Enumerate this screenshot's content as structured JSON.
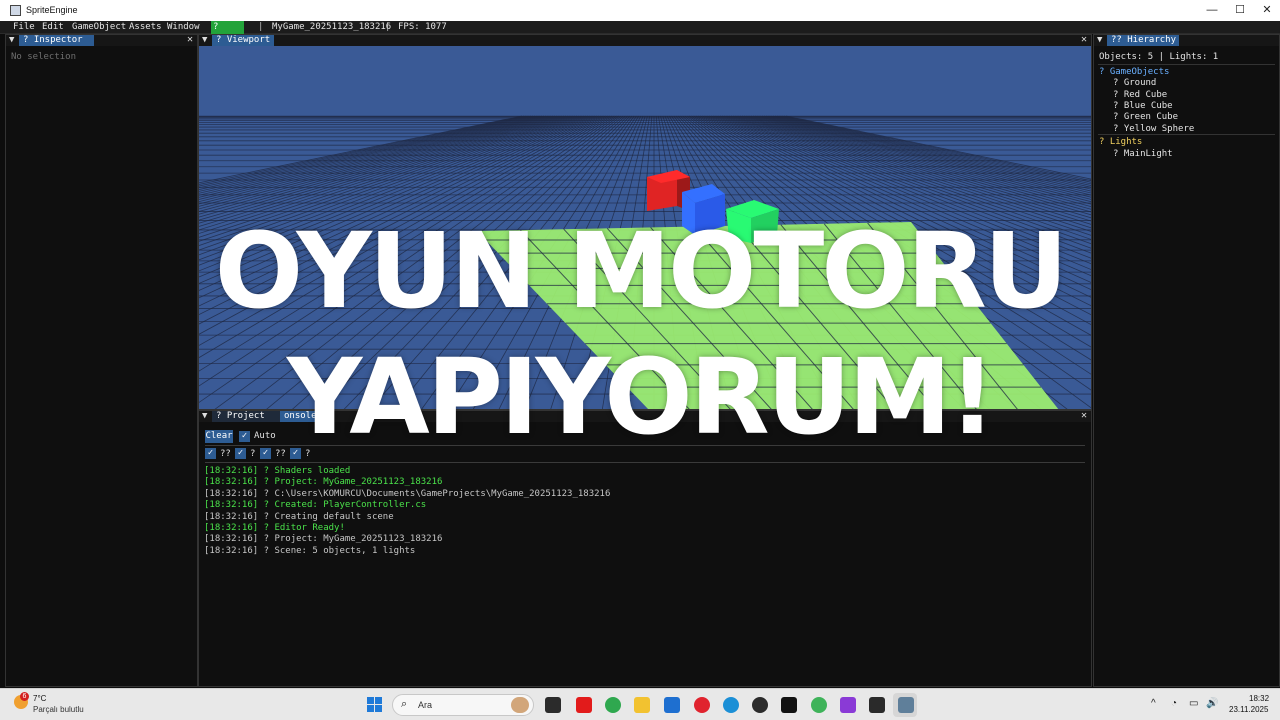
{
  "window": {
    "title": "SpriteEngine",
    "minimize": "—",
    "maximize": "☐",
    "close": "✕"
  },
  "menu": {
    "items": [
      "File",
      "Edit",
      "GameObject",
      "Assets",
      "Window"
    ],
    "play_label": "? Play",
    "separator": "|",
    "project_name": "MyGame_20251123_183216",
    "fps": "FPS: 1077"
  },
  "inspector": {
    "caret": "▼",
    "tab_label": "? Inspector",
    "close": "✕",
    "empty_text": "No selection"
  },
  "viewport": {
    "caret": "▼",
    "tab_label": "? Viewport",
    "close": "✕",
    "colors": {
      "sky": "#3a5a96",
      "grid_line": "#1d2740",
      "ground": "#9ef070",
      "red_cube": "#e02424",
      "blue_cube": "#2a5ae8",
      "green_cube": "#22d060"
    }
  },
  "console": {
    "caret": "▼",
    "tab_project": "? Project",
    "tab_console": "onsole",
    "close": "✕",
    "clear_label": "Clear",
    "auto_label": "Auto",
    "filters": [
      "??",
      "?",
      "??",
      "?"
    ],
    "logs": [
      {
        "text": "[18:32:16] ? Shaders loaded",
        "level": "success"
      },
      {
        "text": "[18:32:16] ? Project: MyGame_20251123_183216",
        "level": "success"
      },
      {
        "text": "[18:32:16] ? C:\\Users\\KOMURCU\\Documents\\GameProjects\\MyGame_20251123_183216",
        "level": "info"
      },
      {
        "text": "[18:32:16] ? Created: PlayerController.cs",
        "level": "success"
      },
      {
        "text": "[18:32:16] ? Creating default scene",
        "level": "info"
      },
      {
        "text": "[18:32:16] ? Editor Ready!",
        "level": "success"
      },
      {
        "text": "[18:32:16] ? Project: MyGame_20251123_183216",
        "level": "info"
      },
      {
        "text": "[18:32:16] ? Scene: 5 objects, 1 lights",
        "level": "info"
      }
    ]
  },
  "hierarchy": {
    "caret": "▼",
    "tab_label": "?? Hierarchy",
    "summary": "Objects: 5 | Lights: 1",
    "gameobjects_label": "? GameObjects",
    "gameobjects": [
      "? Ground",
      "? Red Cube",
      "? Blue Cube",
      "? Green Cube",
      "? Yellow Sphere"
    ],
    "lights_label": "? Lights",
    "lights": [
      "? MainLight"
    ]
  },
  "overlay": {
    "line1": "OYUN MOTORU",
    "line2": "YAPIYORUM!"
  },
  "taskbar": {
    "weather_badge": "6",
    "weather_temp": "7°C",
    "weather_desc": "Parçalı bulutlu",
    "search_placeholder": "Ara",
    "search_icon": "⌕",
    "apps": [
      {
        "name": "file-explorer-taskview-icon",
        "color": "#2b2b2b"
      },
      {
        "name": "youtube-icon",
        "color": "#e21b1b"
      },
      {
        "name": "chrome-icon",
        "color": "#2fa84f"
      },
      {
        "name": "folder-icon",
        "color": "#f2c230"
      },
      {
        "name": "store-icon",
        "color": "#1e6fd0"
      },
      {
        "name": "opera-icon",
        "color": "#e0232e"
      },
      {
        "name": "edge-icon",
        "color": "#1b8fd6"
      },
      {
        "name": "media-player-icon",
        "color": "#2c2c2c"
      },
      {
        "name": "capcut-icon",
        "color": "#111111"
      },
      {
        "name": "chrome-alt-icon",
        "color": "#3fb35a"
      },
      {
        "name": "visual-studio-icon",
        "color": "#8a3ad6"
      },
      {
        "name": "terminal-icon",
        "color": "#2a2a2a"
      },
      {
        "name": "spriteengine-icon",
        "color": "#5f7f9a"
      }
    ],
    "tray": {
      "chevron": "^",
      "wifi": "◔",
      "sound": "🔊"
    },
    "time": "18:32",
    "date": "23.11.2025"
  }
}
